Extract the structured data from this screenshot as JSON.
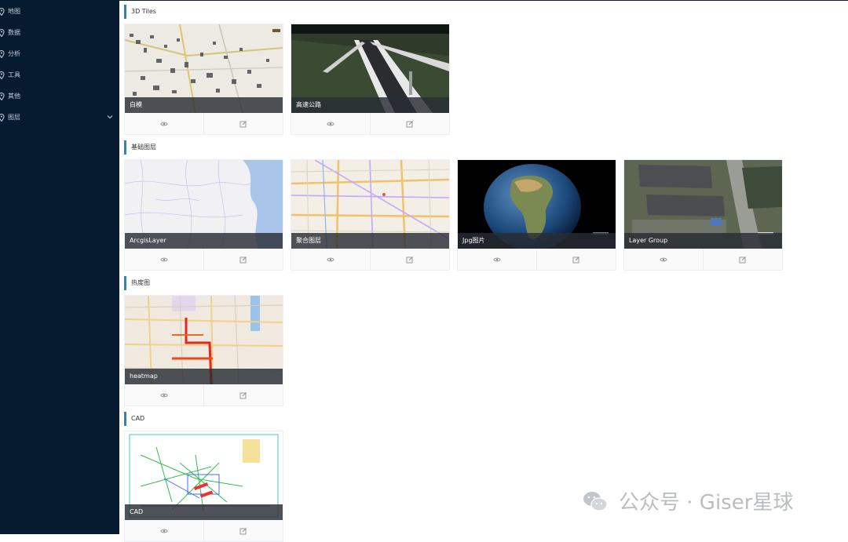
{
  "sidebar": {
    "items": [
      {
        "label": "地图"
      },
      {
        "label": "数据"
      },
      {
        "label": "分析"
      },
      {
        "label": "工具"
      },
      {
        "label": "其他"
      },
      {
        "label": "图层"
      }
    ]
  },
  "sections": [
    {
      "title": "3D Tiles",
      "cards": [
        {
          "caption": "白模"
        },
        {
          "caption": "高速公路"
        }
      ]
    },
    {
      "title": "基础图层",
      "cards": [
        {
          "caption": "ArcgisLayer"
        },
        {
          "caption": "聚合图层"
        },
        {
          "caption": "Jpg图片"
        },
        {
          "caption": "Layer Group"
        }
      ]
    },
    {
      "title": "热度图",
      "cards": [
        {
          "caption": "heatmap"
        }
      ]
    },
    {
      "title": "CAD",
      "cards": [
        {
          "caption": "CAD"
        }
      ]
    }
  ],
  "watermark": {
    "text": "公众号 · Giser星球"
  },
  "icons": {
    "pin": "location-pin-icon",
    "chevron": "chevron-down-icon",
    "view": "eye-icon",
    "edit": "edit-icon",
    "logo": "wechat-icon"
  },
  "colors": {
    "sidebar_bg": "#061a30",
    "accent": "#3f7fa5",
    "caption_bg": "#282d34"
  }
}
